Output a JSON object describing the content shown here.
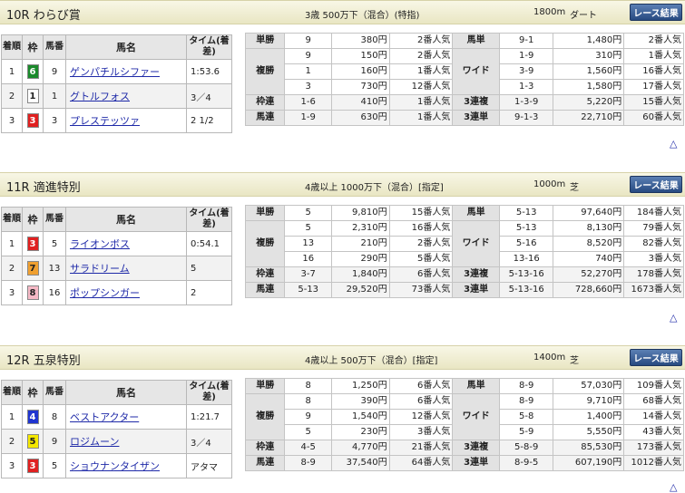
{
  "races": [
    {
      "title": "10R わらび賞",
      "condition": "3歳 500万下（混合）(特指)",
      "distance": "1800m",
      "surface": "ダート",
      "button": "レース結果",
      "headers": {
        "rank": "着順",
        "frame": "枠",
        "num": "馬番",
        "name": "馬名",
        "time": "タイム(着差)"
      },
      "results": [
        {
          "rank": "1",
          "frame": "6",
          "frame_bg": "#1a8a2b",
          "frame_fg": "#ffffff",
          "num": "9",
          "name": "ゲンパチルシファー",
          "time": "1:53.6"
        },
        {
          "rank": "2",
          "frame": "1",
          "frame_bg": "#ffffff",
          "frame_fg": "#222222",
          "num": "1",
          "name": "グトルフォス",
          "time": "3／4"
        },
        {
          "rank": "3",
          "frame": "3",
          "frame_bg": "#e02020",
          "frame_fg": "#ffffff",
          "num": "3",
          "name": "プレステッツァ",
          "time": "2 1/2"
        }
      ],
      "payouts": {
        "tansho": {
          "label": "単勝",
          "rows": [
            {
              "c": "9",
              "a": "380円",
              "p": "2番人気"
            }
          ]
        },
        "fukusho": {
          "label": "複勝",
          "rows": [
            {
              "c": "9",
              "a": "150円",
              "p": "2番人気"
            },
            {
              "c": "1",
              "a": "160円",
              "p": "1番人気"
            },
            {
              "c": "3",
              "a": "730円",
              "p": "12番人気"
            }
          ]
        },
        "wakuren": {
          "label": "枠連",
          "rows": [
            {
              "c": "1-6",
              "a": "410円",
              "p": "1番人気"
            }
          ]
        },
        "umaren": {
          "label": "馬連",
          "rows": [
            {
              "c": "1-9",
              "a": "630円",
              "p": "1番人気"
            }
          ]
        },
        "umatan": {
          "label": "馬単",
          "rows": [
            {
              "c": "9-1",
              "a": "1,480円",
              "p": "2番人気"
            }
          ]
        },
        "wide": {
          "label": "ワイド",
          "rows": [
            {
              "c": "1-9",
              "a": "310円",
              "p": "1番人気"
            },
            {
              "c": "3-9",
              "a": "1,560円",
              "p": "16番人気"
            },
            {
              "c": "1-3",
              "a": "1,580円",
              "p": "17番人気"
            }
          ]
        },
        "sanrenpuku": {
          "label": "3連複",
          "rows": [
            {
              "c": "1-3-9",
              "a": "5,220円",
              "p": "15番人気"
            }
          ]
        },
        "sanrentan": {
          "label": "3連単",
          "rows": [
            {
              "c": "9-1-3",
              "a": "22,710円",
              "p": "60番人気"
            }
          ]
        }
      }
    },
    {
      "title": "11R 適進特別",
      "condition": "4歳以上 1000万下（混合）[指定]",
      "distance": "1000m",
      "surface": "芝",
      "button": "レース結果",
      "headers": {
        "rank": "着順",
        "frame": "枠",
        "num": "馬番",
        "name": "馬名",
        "time": "タイム(着差)"
      },
      "results": [
        {
          "rank": "1",
          "frame": "3",
          "frame_bg": "#e02020",
          "frame_fg": "#ffffff",
          "num": "5",
          "name": "ライオンボス",
          "time": "0:54.1"
        },
        {
          "rank": "2",
          "frame": "7",
          "frame_bg": "#f0a030",
          "frame_fg": "#222222",
          "num": "13",
          "name": "サラドリーム",
          "time": "5"
        },
        {
          "rank": "3",
          "frame": "8",
          "frame_bg": "#f6b9c6",
          "frame_fg": "#222222",
          "num": "16",
          "name": "ポップシンガー",
          "time": "2"
        }
      ],
      "payouts": {
        "tansho": {
          "label": "単勝",
          "rows": [
            {
              "c": "5",
              "a": "9,810円",
              "p": "15番人気"
            }
          ]
        },
        "fukusho": {
          "label": "複勝",
          "rows": [
            {
              "c": "5",
              "a": "2,310円",
              "p": "16番人気"
            },
            {
              "c": "13",
              "a": "210円",
              "p": "2番人気"
            },
            {
              "c": "16",
              "a": "290円",
              "p": "5番人気"
            }
          ]
        },
        "wakuren": {
          "label": "枠連",
          "rows": [
            {
              "c": "3-7",
              "a": "1,840円",
              "p": "6番人気"
            }
          ]
        },
        "umaren": {
          "label": "馬連",
          "rows": [
            {
              "c": "5-13",
              "a": "29,520円",
              "p": "73番人気"
            }
          ]
        },
        "umatan": {
          "label": "馬単",
          "rows": [
            {
              "c": "5-13",
              "a": "97,640円",
              "p": "184番人気"
            }
          ]
        },
        "wide": {
          "label": "ワイド",
          "rows": [
            {
              "c": "5-13",
              "a": "8,130円",
              "p": "79番人気"
            },
            {
              "c": "5-16",
              "a": "8,520円",
              "p": "82番人気"
            },
            {
              "c": "13-16",
              "a": "740円",
              "p": "3番人気"
            }
          ]
        },
        "sanrenpuku": {
          "label": "3連複",
          "rows": [
            {
              "c": "5-13-16",
              "a": "52,270円",
              "p": "178番人気"
            }
          ]
        },
        "sanrentan": {
          "label": "3連単",
          "rows": [
            {
              "c": "5-13-16",
              "a": "728,660円",
              "p": "1673番人気"
            }
          ]
        }
      }
    },
    {
      "title": "12R 五泉特別",
      "condition": "4歳以上 500万下（混合）[指定]",
      "distance": "1400m",
      "surface": "芝",
      "button": "レース結果",
      "headers": {
        "rank": "着順",
        "frame": "枠",
        "num": "馬番",
        "name": "馬名",
        "time": "タイム(着差)"
      },
      "results": [
        {
          "rank": "1",
          "frame": "4",
          "frame_bg": "#2035d0",
          "frame_fg": "#ffffff",
          "num": "8",
          "name": "ベストアクター",
          "time": "1:21.7"
        },
        {
          "rank": "2",
          "frame": "5",
          "frame_bg": "#f5e800",
          "frame_fg": "#222222",
          "num": "9",
          "name": "ロジムーン",
          "time": "3／4"
        },
        {
          "rank": "3",
          "frame": "3",
          "frame_bg": "#e02020",
          "frame_fg": "#ffffff",
          "num": "5",
          "name": "ショウナンタイザン",
          "time": "アタマ"
        }
      ],
      "payouts": {
        "tansho": {
          "label": "単勝",
          "rows": [
            {
              "c": "8",
              "a": "1,250円",
              "p": "6番人気"
            }
          ]
        },
        "fukusho": {
          "label": "複勝",
          "rows": [
            {
              "c": "8",
              "a": "390円",
              "p": "6番人気"
            },
            {
              "c": "9",
              "a": "1,540円",
              "p": "12番人気"
            },
            {
              "c": "5",
              "a": "230円",
              "p": "3番人気"
            }
          ]
        },
        "wakuren": {
          "label": "枠連",
          "rows": [
            {
              "c": "4-5",
              "a": "4,770円",
              "p": "21番人気"
            }
          ]
        },
        "umaren": {
          "label": "馬連",
          "rows": [
            {
              "c": "8-9",
              "a": "37,540円",
              "p": "64番人気"
            }
          ]
        },
        "umatan": {
          "label": "馬単",
          "rows": [
            {
              "c": "8-9",
              "a": "57,030円",
              "p": "109番人気"
            }
          ]
        },
        "wide": {
          "label": "ワイド",
          "rows": [
            {
              "c": "8-9",
              "a": "9,710円",
              "p": "68番人気"
            },
            {
              "c": "5-8",
              "a": "1,400円",
              "p": "14番人気"
            },
            {
              "c": "5-9",
              "a": "5,550円",
              "p": "43番人気"
            }
          ]
        },
        "sanrenpuku": {
          "label": "3連複",
          "rows": [
            {
              "c": "5-8-9",
              "a": "85,530円",
              "p": "173番人気"
            }
          ]
        },
        "sanrentan": {
          "label": "3連単",
          "rows": [
            {
              "c": "8-9-5",
              "a": "607,190円",
              "p": "1012番人気"
            }
          ]
        }
      }
    }
  ],
  "back_to_top": "△"
}
